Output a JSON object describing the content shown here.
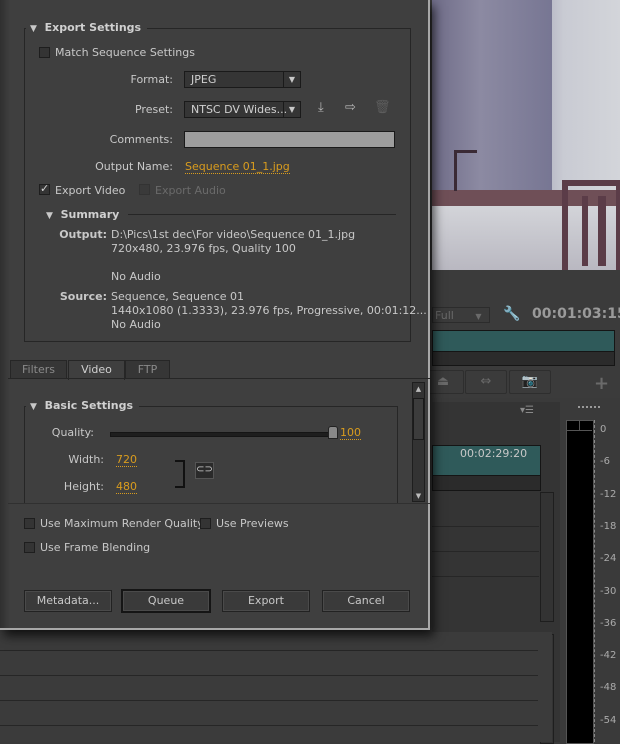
{
  "dialog": {
    "export_settings": {
      "title": "Export Settings",
      "match_sequence": {
        "label": "Match Sequence Settings",
        "checked": false
      },
      "format": {
        "label": "Format:",
        "value": "JPEG"
      },
      "preset": {
        "label": "Preset:",
        "value": "NTSC DV Wides...",
        "icons": [
          "save-preset-icon",
          "import-preset-icon",
          "delete-preset-icon"
        ]
      },
      "comments": {
        "label": "Comments:",
        "value": ""
      },
      "output_name": {
        "label": "Output Name:",
        "value": "Sequence 01_1.jpg"
      },
      "export_video": {
        "label": "Export Video",
        "checked": true
      },
      "export_audio": {
        "label": "Export Audio",
        "checked": false,
        "disabled": true
      }
    },
    "summary": {
      "title": "Summary",
      "output_label": "Output:",
      "output_lines": [
        "D:\\Pics\\1st dec\\For video\\Sequence 01_1.jpg",
        "720x480, 23.976 fps, Quality 100",
        "No Audio"
      ],
      "source_label": "Source:",
      "source_lines": [
        "Sequence, Sequence 01",
        "1440x1080 (1.3333), 23.976 fps, Progressive, 00:01:12...",
        "No Audio"
      ]
    },
    "tabs": [
      {
        "label": "Filters",
        "active": false
      },
      {
        "label": "Video",
        "active": true
      },
      {
        "label": "FTP",
        "active": false
      }
    ],
    "basic_settings": {
      "title": "Basic Settings",
      "quality": {
        "label": "Quality:",
        "value": "100",
        "fraction": 1.0
      },
      "width": {
        "label": "Width:",
        "value": "720"
      },
      "height": {
        "label": "Height:",
        "value": "480"
      }
    },
    "options": {
      "max_render_quality": {
        "label": "Use Maximum Render Quality",
        "checked": false
      },
      "use_previews": {
        "label": "Use Previews",
        "checked": false
      },
      "frame_blending": {
        "label": "Use Frame Blending",
        "checked": false
      }
    },
    "buttons": {
      "metadata": "Metadata...",
      "queue": "Queue",
      "export": "Export",
      "cancel": "Cancel"
    }
  },
  "background": {
    "program_monitor": {
      "resolution": "Full",
      "timecode": "00:01:03:15"
    },
    "sequence": {
      "timecode": "00:02:29:20"
    },
    "audio_meter": {
      "scale": [
        "0",
        "-6",
        "-12",
        "-18",
        "-24",
        "-30",
        "-36",
        "-42",
        "-48",
        "-54"
      ]
    }
  }
}
